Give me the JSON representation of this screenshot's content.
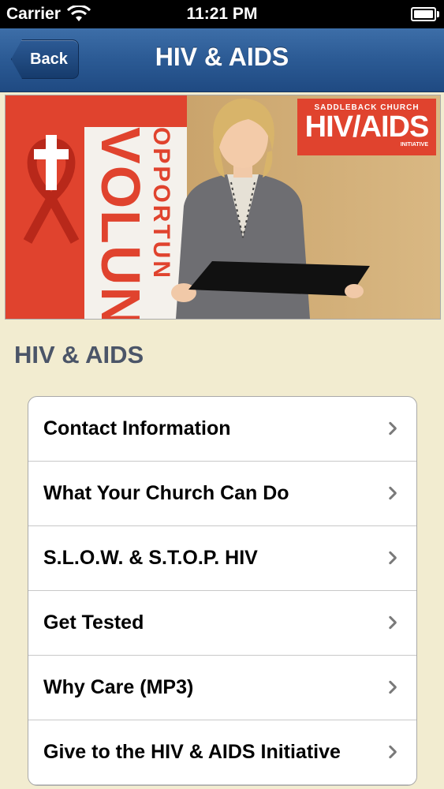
{
  "status_bar": {
    "carrier": "Carrier",
    "time": "11:21 PM"
  },
  "nav": {
    "back_label": "Back",
    "title": "HIV & AIDS"
  },
  "hero": {
    "banner_text_large": "VOLUN",
    "banner_text_small": "OPPORTUN",
    "logo_top": "SADDLEBACK CHURCH",
    "logo_main": "HIV/AIDS",
    "logo_bottom": "INITIATIVE"
  },
  "section": {
    "title": "HIV & AIDS"
  },
  "menu": {
    "items": [
      {
        "label": "Contact Information"
      },
      {
        "label": "What Your Church Can Do"
      },
      {
        "label": "S.L.O.W. & S.T.O.P. HIV"
      },
      {
        "label": "Get Tested"
      },
      {
        "label": "Why Care (MP3)"
      },
      {
        "label": "Give to the HIV & AIDS Initiative"
      }
    ]
  },
  "colors": {
    "nav_blue": "#2b5a94",
    "background": "#f2ecd0",
    "section_title": "#4b5568",
    "banner_red": "#e0432e"
  }
}
